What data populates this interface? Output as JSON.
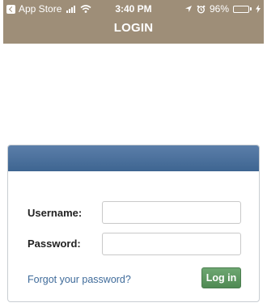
{
  "status_bar": {
    "back_app": "App Store",
    "time": "3:40 PM",
    "battery": "96%",
    "battery_level": 0.96,
    "icons": [
      "back-arrow-icon",
      "signal-icon",
      "wifi-icon",
      "location-icon",
      "alarm-icon",
      "battery-icon",
      "charging-icon"
    ]
  },
  "header": {
    "title": "LOGIN"
  },
  "form": {
    "username_label": "Username:",
    "username_value": "",
    "password_label": "Password:",
    "password_value": "",
    "forgot_link": "Forgot your password?",
    "login_button": "Log in"
  },
  "colors": {
    "topbar": "#9e8e78",
    "panel_header": "#4a6f9a",
    "button": "#5e9a62",
    "link": "#3f6b9a"
  }
}
